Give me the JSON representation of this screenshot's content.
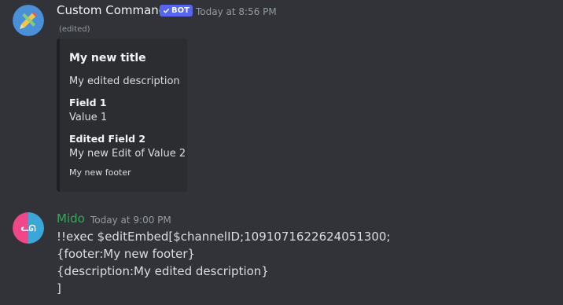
{
  "messages": [
    {
      "author": "Custom Command",
      "author_color": "#f2f3f5",
      "bot_tag": "BOT",
      "timestamp": "Today at 8:56 PM",
      "edited": "(edited)",
      "embed": {
        "title": "My new title",
        "description": "My edited description",
        "fields": [
          {
            "name": "Field 1",
            "value": "Value 1"
          },
          {
            "name": "Edited Field 2",
            "value": "My new Edit of Value 2"
          }
        ],
        "footer": "My new footer"
      }
    },
    {
      "author": "Mido",
      "author_color": "#3ba55d",
      "timestamp": "Today at 9:00 PM",
      "lines": [
        "!!exec $editEmbed[$channelID;1091071622624051300;",
        "{footer:My new footer}",
        "{description:My edited description}",
        "]"
      ]
    }
  ],
  "icons": {
    "bot_avatar": "pencil-ruler-avatar-icon",
    "user_avatar": "gamepad-avatar-icon",
    "verified_check": "check-icon"
  },
  "colors": {
    "background": "#313338",
    "embed_background": "#2b2d31",
    "bot_tag": "#5865f2"
  }
}
